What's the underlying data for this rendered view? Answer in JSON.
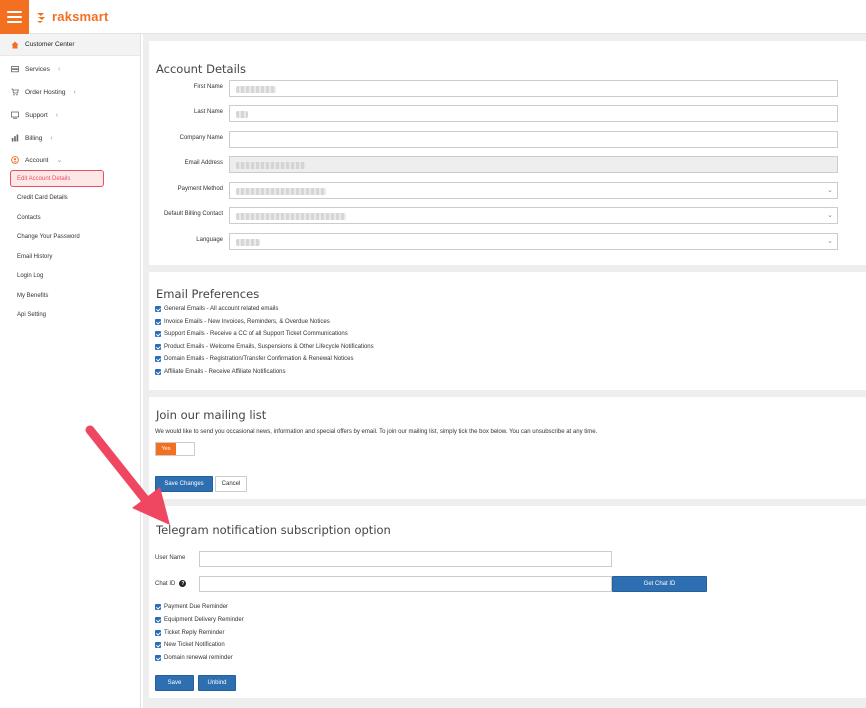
{
  "brand": {
    "name": "raksmart",
    "color": "#f37021"
  },
  "sidebar": {
    "top_item": {
      "label": "Customer Center",
      "icon": "home-icon"
    },
    "items": [
      {
        "label": "Services",
        "icon": "services-icon"
      },
      {
        "label": "Order Hosting",
        "icon": "cart-icon"
      },
      {
        "label": "Support",
        "icon": "support-icon"
      },
      {
        "label": "Billing",
        "icon": "billing-icon"
      },
      {
        "label": "Account",
        "icon": "account-icon"
      }
    ],
    "account_subitems": [
      {
        "label": "Edit Account Details",
        "active": true
      },
      {
        "label": "Credit Card Details"
      },
      {
        "label": "Contacts"
      },
      {
        "label": "Change Your Password"
      },
      {
        "label": "Email History"
      },
      {
        "label": "Login Log"
      },
      {
        "label": "My Benefits"
      },
      {
        "label": "Api Setting"
      }
    ]
  },
  "account_details": {
    "title": "Account Details",
    "fields": [
      {
        "label": "First Name"
      },
      {
        "label": "Last Name"
      },
      {
        "label": "Company Name"
      },
      {
        "label": "Email Address"
      },
      {
        "label": "Payment Method"
      },
      {
        "label": "Default Billing Contact"
      },
      {
        "label": "Language"
      }
    ]
  },
  "email_preferences": {
    "title": "Email Preferences",
    "options": [
      {
        "label": "General Emails - All account related emails",
        "checked": true
      },
      {
        "label": "Invoice Emails - New Invoices, Reminders, & Overdue Notices",
        "checked": true
      },
      {
        "label": "Support Emails - Receive a CC of all Support Ticket Communications",
        "checked": true
      },
      {
        "label": "Product Emails - Welcome Emails, Suspensions & Other Lifecycle Notifications",
        "checked": true
      },
      {
        "label": "Domain Emails - Registration/Transfer Confirmation & Renewal Notices",
        "checked": true
      },
      {
        "label": "Affiliate Emails - Receive Affiliate Notifications",
        "checked": true
      }
    ]
  },
  "mailing_list": {
    "title": "Join our mailing list",
    "description": "We would like to send you occasional news, information and special offers by email. To join our mailing list, simply tick the box below. You can unsubscribe at any time.",
    "toggle_label": "Yes",
    "toggle_on": true
  },
  "actions": {
    "save_changes": "Save Changes",
    "cancel": "Cancel"
  },
  "telegram": {
    "title": "Telegram notification subscription option",
    "user_name_label": "User Name",
    "chat_id_label": "Chat ID",
    "help_glyph": "?",
    "get_chat_id_button": "Get Chat ID",
    "reminders": [
      {
        "label": "Payment Due Reminder",
        "checked": true
      },
      {
        "label": "Equipment Delivery Reminder",
        "checked": true
      },
      {
        "label": "Ticket Reply Reminder",
        "checked": true
      },
      {
        "label": "New Ticket Notification",
        "checked": true
      },
      {
        "label": "Domain renewal reminder",
        "checked": true
      }
    ],
    "save_button": "Save",
    "unbind_button": "Unbind"
  },
  "colors": {
    "primary": "#2d6fb0",
    "accent": "#f37021",
    "highlight": "#e94f63"
  }
}
